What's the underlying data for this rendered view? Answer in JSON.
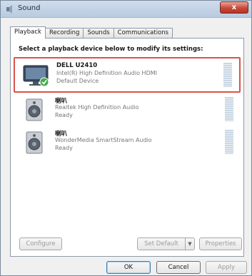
{
  "window": {
    "title": "Sound",
    "close_glyph": "x"
  },
  "tabs": [
    {
      "label": "Playback",
      "active": true
    },
    {
      "label": "Recording",
      "active": false
    },
    {
      "label": "Sounds",
      "active": false
    },
    {
      "label": "Communications",
      "active": false
    }
  ],
  "instruction": "Select a playback device below to modify its settings:",
  "devices": [
    {
      "name": "DELL U2410",
      "description": "Intel(R) High Definition Audio HDMI",
      "status": "Default Device",
      "icon": "monitor-icon",
      "selected": true
    },
    {
      "name": "喇叭",
      "description": "Realtek High Definition Audio",
      "status": "Ready",
      "icon": "speaker-icon",
      "selected": false
    },
    {
      "name": "喇叭",
      "description": "WonderMedia SmartStream Audio",
      "status": "Ready",
      "icon": "speaker-icon",
      "selected": false
    }
  ],
  "buttons": {
    "configure": "Configure",
    "set_default": "Set Default",
    "properties": "Properties",
    "ok": "OK",
    "cancel": "Cancel",
    "apply": "Apply"
  },
  "colors": {
    "selection_border": "#d9534a",
    "titlebar": "#c4d4e8",
    "default_check": "#3fae49"
  }
}
